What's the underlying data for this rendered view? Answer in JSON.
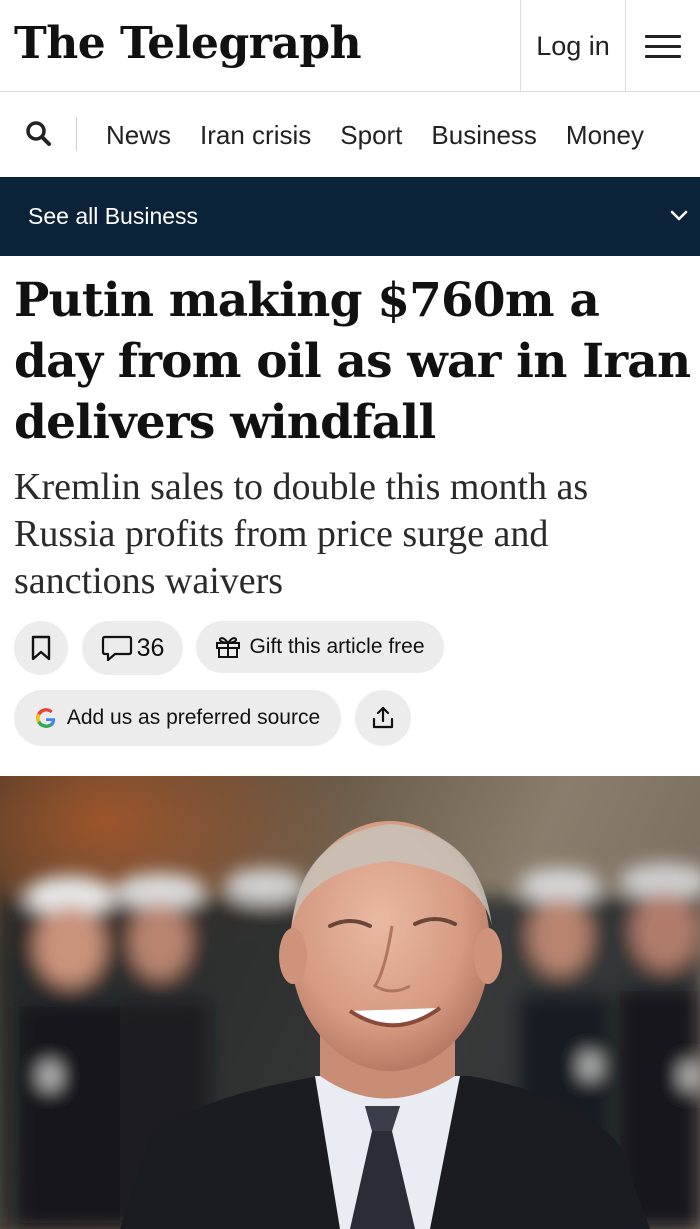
{
  "header": {
    "masthead": "The Telegraph",
    "login_label": "Log in"
  },
  "nav": {
    "items": [
      "News",
      "Iran crisis",
      "Sport",
      "Business",
      "Money"
    ]
  },
  "section_bar": {
    "label": "See all Business"
  },
  "article": {
    "headline": "Putin making $760m a day from oil as war in Iran delivers windfall",
    "standfirst": "Kremlin sales to double this month as Russia profits from price surge and sanctions waivers",
    "comment_count": "36",
    "gift_label": "Gift this article free",
    "source_label": "Add us as preferred source"
  },
  "icons": {
    "search": "search-icon",
    "menu": "hamburger-menu-icon",
    "chevron": "chevron-down-icon",
    "bookmark": "bookmark-icon",
    "comment": "comment-icon",
    "gift": "gift-icon",
    "google": "google-g-icon",
    "share": "share-icon"
  },
  "colors": {
    "section_bar_bg": "#0b2338",
    "pill_bg": "#ececec",
    "text": "#111111"
  }
}
